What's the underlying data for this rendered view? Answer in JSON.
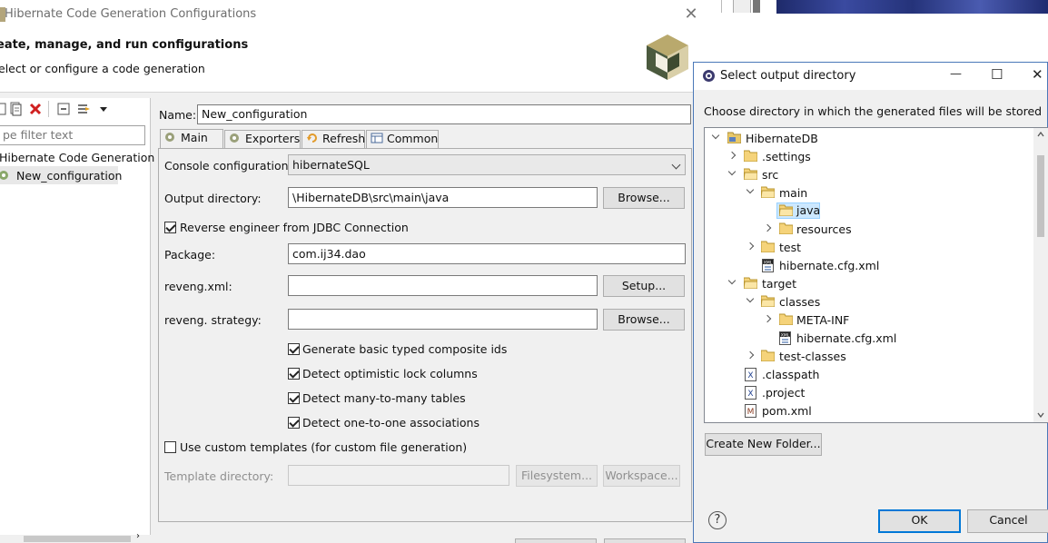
{
  "main_dialog": {
    "title": "Hibernate Code Generation Configurations",
    "close_glyph": "✕",
    "banner": {
      "title": "eate, manage, and run configurations",
      "message": "elect or configure a code generation"
    },
    "left_panel": {
      "filter_placeholder": "pe filter text",
      "tree": [
        {
          "label": "Hibernate Code Generation"
        },
        {
          "label": "New_configuration",
          "selected": true
        }
      ]
    },
    "name_label": "Name:",
    "name_value": "New_configuration",
    "tabs": [
      {
        "label": "Main",
        "icon": "main-tab-icon",
        "active": true
      },
      {
        "label": "Exporters",
        "icon": "exporters-tab-icon"
      },
      {
        "label": "Refresh",
        "icon": "refresh-tab-icon"
      },
      {
        "label": "Common",
        "icon": "common-tab-icon"
      }
    ],
    "main_tab": {
      "console_config_label": "Console configuration:",
      "console_config_value": "hibernateSQL",
      "output_dir_label": "Output directory:",
      "output_dir_value": "\\HibernateDB\\src\\main\\java",
      "browse_label": "Browse...",
      "reverse_engineer_label": "Reverse engineer from JDBC Connection",
      "reverse_engineer_checked": true,
      "package_label": "Package:",
      "package_value": "com.ij34.dao",
      "reveng_xml_label": "reveng.xml:",
      "reveng_xml_value": "",
      "setup_label": "Setup...",
      "reveng_strategy_label": "reveng. strategy:",
      "reveng_strategy_value": "",
      "browse2_label": "Browse...",
      "options": [
        {
          "label": "Generate basic typed composite ids",
          "checked": true
        },
        {
          "label": "Detect optimistic lock columns",
          "checked": true
        },
        {
          "label": "Detect many-to-many tables",
          "checked": true
        },
        {
          "label": "Detect one-to-one associations",
          "checked": true
        }
      ],
      "custom_templates_label": "Use custom templates (for custom file generation)",
      "custom_templates_checked": false,
      "template_dir_label": "Template directory:",
      "template_dir_value": "",
      "filesystem_label": "Filesystem...",
      "workspace_label": "Workspace..."
    }
  },
  "dir_dialog": {
    "title": "Select output directory",
    "minimize_glyph": "—",
    "maximize_glyph": "☐",
    "close_glyph": "✕",
    "message": "Choose directory in which the generated files will be stored",
    "tree": [
      {
        "label": "HibernateDB",
        "icon": "project-icon",
        "expand": "open"
      },
      {
        "label": ".settings",
        "icon": "folder-icon",
        "expand": "closed"
      },
      {
        "label": "src",
        "icon": "folder-icon",
        "expand": "open"
      },
      {
        "label": "main",
        "icon": "folder-icon",
        "expand": "open"
      },
      {
        "label": "java",
        "icon": "folder-icon",
        "expand": "none",
        "selected": true
      },
      {
        "label": "resources",
        "icon": "folder-icon",
        "expand": "closed"
      },
      {
        "label": "test",
        "icon": "folder-icon",
        "expand": "closed"
      },
      {
        "label": "hibernate.cfg.xml",
        "icon": "xml-file-icon",
        "expand": "none"
      },
      {
        "label": "target",
        "icon": "folder-icon",
        "expand": "open"
      },
      {
        "label": "classes",
        "icon": "folder-icon",
        "expand": "open"
      },
      {
        "label": "META-INF",
        "icon": "folder-icon",
        "expand": "closed"
      },
      {
        "label": "hibernate.cfg.xml",
        "icon": "xml-file-icon",
        "expand": "none"
      },
      {
        "label": "test-classes",
        "icon": "folder-icon",
        "expand": "closed"
      },
      {
        "label": ".classpath",
        "icon": "x-file-icon",
        "expand": "none"
      },
      {
        "label": ".project",
        "icon": "x-file-icon",
        "expand": "none"
      },
      {
        "label": "pom.xml",
        "icon": "maven-file-icon",
        "expand": "none"
      }
    ],
    "create_folder_label": "Create New Folder...",
    "help_glyph": "?",
    "ok_label": "OK",
    "cancel_label": "Cancel"
  }
}
